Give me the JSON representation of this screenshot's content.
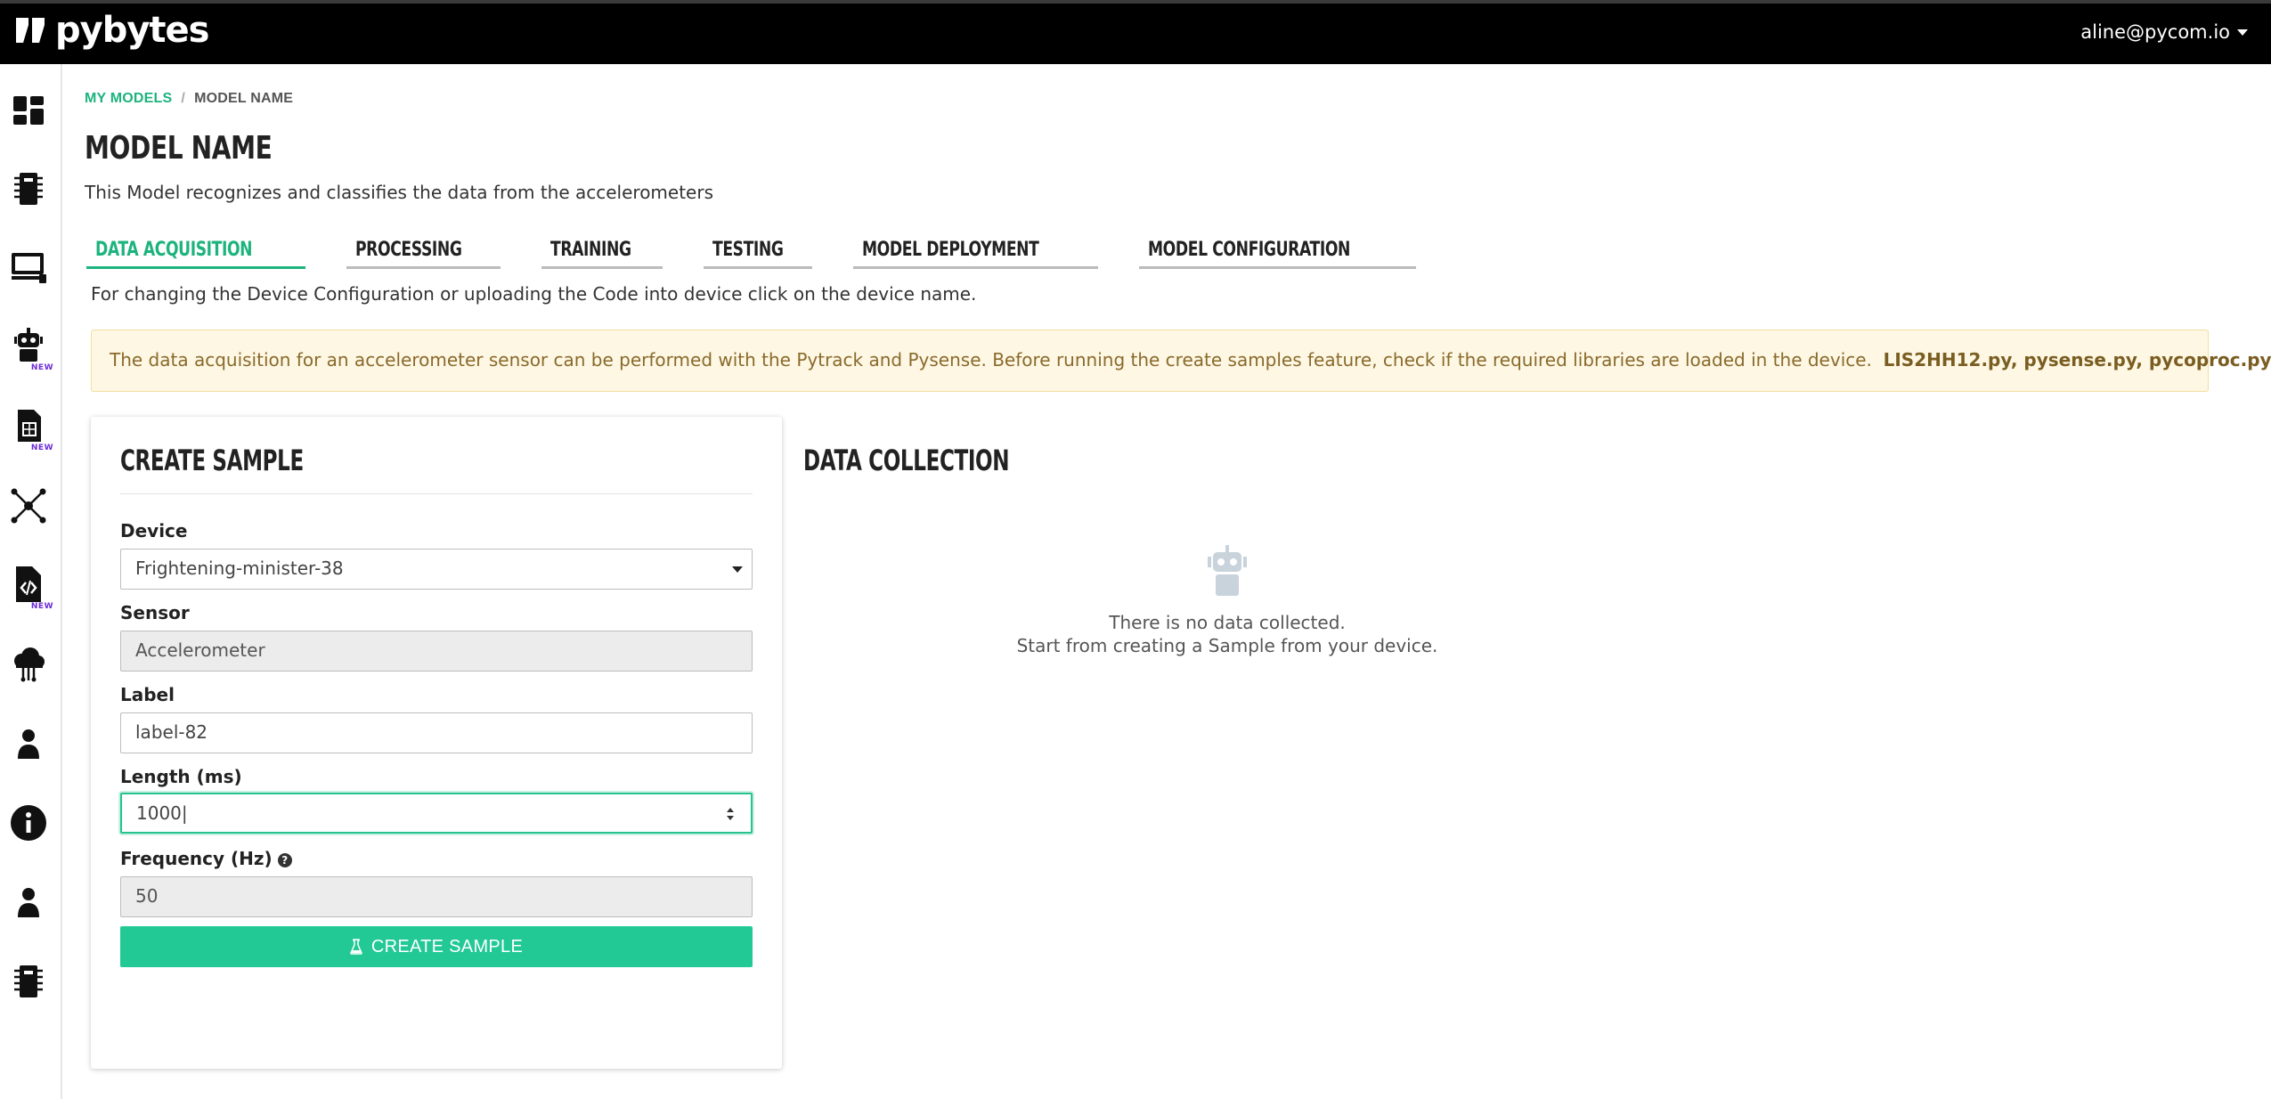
{
  "app": {
    "logo_text": "pybytes",
    "user_email": "aline@pycom.io"
  },
  "sidebar": {
    "items": [
      {
        "name": "dashboard",
        "icon": "dashboard-icon"
      },
      {
        "name": "devices",
        "icon": "chip-icon"
      },
      {
        "name": "pyconfig",
        "icon": "monitor-icon"
      },
      {
        "name": "machine-learning",
        "icon": "robot-icon",
        "badge": "NEW"
      },
      {
        "name": "sim",
        "icon": "sim-card-icon",
        "badge": "NEW"
      },
      {
        "name": "networks",
        "icon": "network-icon"
      },
      {
        "name": "scripts",
        "icon": "code-file-icon",
        "badge": "NEW"
      },
      {
        "name": "integrations",
        "icon": "cloud-icon"
      },
      {
        "name": "account",
        "icon": "user-icon"
      },
      {
        "name": "info",
        "icon": "info-icon"
      },
      {
        "name": "team",
        "icon": "user-icon"
      },
      {
        "name": "firmware",
        "icon": "chip-icon"
      }
    ]
  },
  "breadcrumb": {
    "parent": "MY MODELS",
    "separator": "/",
    "current": "MODEL NAME"
  },
  "page": {
    "title": "MODEL NAME",
    "description": "This Model recognizes and classifies the data from the accelerometers"
  },
  "tabs": [
    {
      "label": "DATA ACQUISITION",
      "active": true
    },
    {
      "label": "PROCESSING",
      "active": false
    },
    {
      "label": "TRAINING",
      "active": false
    },
    {
      "label": "TESTING",
      "active": false
    },
    {
      "label": "MODEL DEPLOYMENT",
      "active": false
    },
    {
      "label": "MODEL CONFIGURATION",
      "active": false
    }
  ],
  "hint": "For changing the Device Configuration or uploading the Code into device click on the device name.",
  "alert": {
    "text": "The data acquisition for an accelerometer sensor can be performed with the Pytrack and Pysense. Before running the create samples feature, check if the required libraries are loaded in the device.",
    "libraries": "LIS2HH12.py, pysense.py, pycoproc.py"
  },
  "create_sample": {
    "title": "CREATE SAMPLE",
    "device_label": "Device",
    "device_value": "Frightening-minister-38",
    "sensor_label": "Sensor",
    "sensor_value": "Accelerometer",
    "label_label": "Label",
    "label_value": "label-82",
    "length_label": "Length (ms)",
    "length_value": "1000|",
    "frequency_label": "Frequency (Hz)",
    "frequency_value": "50",
    "button_label": "CREATE SAMPLE"
  },
  "data_collection": {
    "title": "DATA COLLECTION",
    "empty_line1": "There is no data collected.",
    "empty_line2": "Start from creating a Sample from your device."
  },
  "colors": {
    "accent": "#1db37e",
    "button": "#22c995",
    "alert_bg": "#fdf7e4",
    "topbar": "#000000"
  }
}
